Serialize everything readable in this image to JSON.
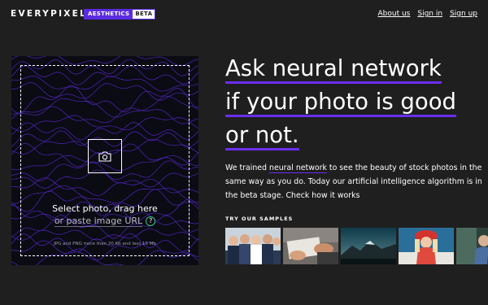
{
  "header": {
    "logo": "EVERYPIXEL",
    "tag_primary": "AESTHETICS",
    "tag_secondary": "BETA",
    "nav": [
      {
        "label": "About us"
      },
      {
        "label": "Sign in"
      },
      {
        "label": "Sign up"
      }
    ]
  },
  "upload": {
    "select_text": "Select photo, drag here",
    "paste_text": "or paste image URL",
    "help_symbol": "?",
    "limits": "JPG and PNG more than 20 Kb and less 10 Mb"
  },
  "hero": {
    "headline_lines": [
      "Ask neural network",
      "if your photo is good",
      "or not."
    ],
    "desc_link": "neural network",
    "desc_before": "We trained ",
    "desc_after": " to see the beauty of stock photos in the same way as you do. Today our artificial intelligence algorithm is in the beta stage. Check how it works"
  },
  "samples": {
    "title": "TRY OUR SAMPLES",
    "items": [
      {
        "name": "business-team-photo"
      },
      {
        "name": "desk-hands-photo"
      },
      {
        "name": "mountain-landscape-photo"
      },
      {
        "name": "woman-red-hat-photo"
      },
      {
        "name": "couple-photo"
      }
    ]
  },
  "colors": {
    "background": "#1f1f1f",
    "accent": "#6b2ef0",
    "help_ring": "#2ec27e"
  }
}
